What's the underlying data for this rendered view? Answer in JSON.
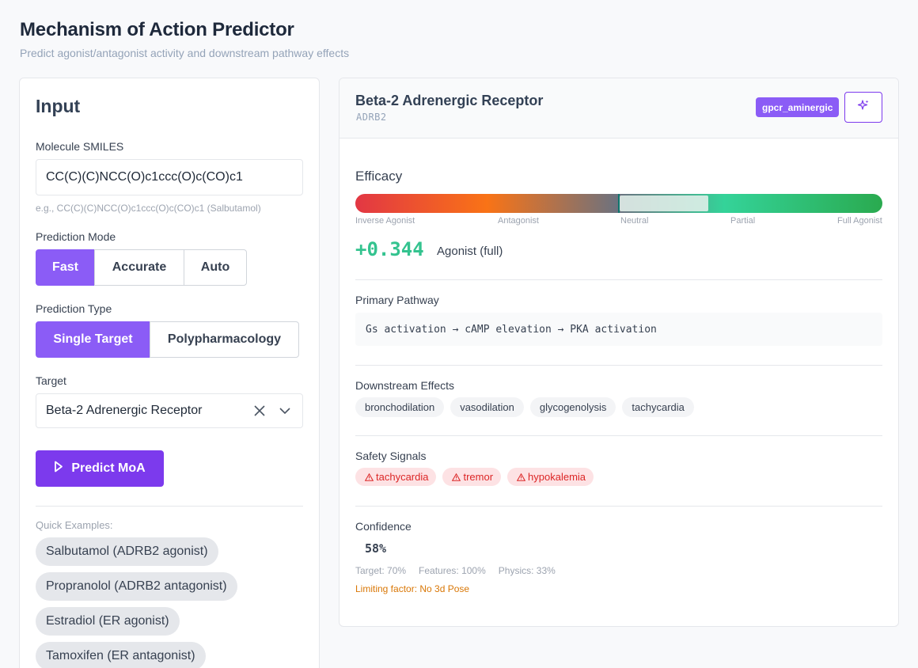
{
  "header": {
    "title": "Mechanism of Action Predictor",
    "subtitle": "Predict agonist/antagonist activity and downstream pathway effects"
  },
  "input": {
    "title": "Input",
    "smiles_label": "Molecule SMILES",
    "smiles_value": "CC(C)(C)NCC(O)c1ccc(O)c(CO)c1",
    "smiles_hint": "e.g., CC(C)(C)NCC(O)c1ccc(O)c(CO)c1 (Salbutamol)",
    "mode_label": "Prediction Mode",
    "modes": [
      "Fast",
      "Accurate",
      "Auto"
    ],
    "mode_selected": "Fast",
    "type_label": "Prediction Type",
    "types": [
      "Single Target",
      "Polypharmacology"
    ],
    "type_selected": "Single Target",
    "target_label": "Target",
    "target_value": "Beta-2 Adrenergic Receptor",
    "predict_label": "Predict MoA",
    "quick_label": "Quick Examples:",
    "examples": [
      "Salbutamol (ADRB2 agonist)",
      "Propranolol (ADRB2 antagonist)",
      "Estradiol (ER agonist)",
      "Tamoxifen (ER antagonist)"
    ]
  },
  "result": {
    "target_name": "Beta-2 Adrenergic Receptor",
    "gene": "ADRB2",
    "family": "gpcr_aminergic",
    "efficacy_title": "Efficacy",
    "efficacy_value": 0.344,
    "efficacy_ticks": [
      "Inverse Agonist",
      "Antagonist",
      "Neutral",
      "Partial",
      "Full Agonist"
    ],
    "score": "+0.344",
    "score_label": "Agonist (full)",
    "pathway_title": "Primary Pathway",
    "pathway": "Gs activation → cAMP elevation → PKA activation",
    "effects_title": "Downstream Effects",
    "effects": [
      "bronchodilation",
      "vasodilation",
      "glycogenolysis",
      "tachycardia"
    ],
    "safety_title": "Safety Signals",
    "safety": [
      "tachycardia",
      "tremor",
      "hypokalemia"
    ],
    "confidence_title": "Confidence",
    "confidence": "58%",
    "breakdown": [
      "Target: 70%",
      "Features: 100%",
      "Physics: 33%"
    ],
    "limiting": "Limiting factor: No 3d Pose"
  },
  "colors": {
    "accent": "#8b5cf6",
    "primary_button": "#7c3aed",
    "score": "#34c38f",
    "safety": "#dc2626",
    "warning": "#d97706"
  }
}
